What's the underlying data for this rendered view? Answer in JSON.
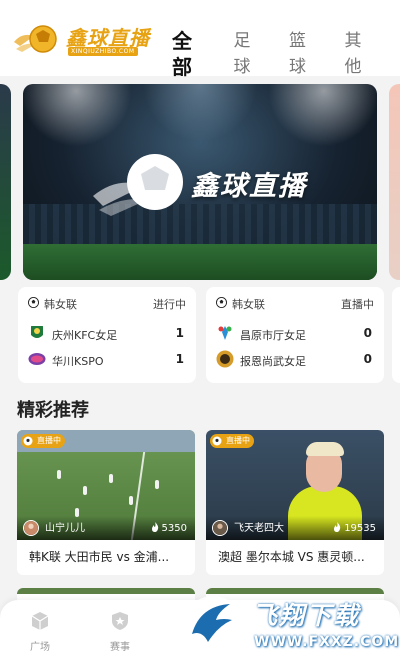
{
  "header": {
    "logo_title": "鑫球直播",
    "logo_subtitle": "XINQIUZHIBO.COM",
    "tabs": [
      {
        "label": "全部",
        "active": true
      },
      {
        "label": "足球",
        "active": false
      },
      {
        "label": "篮球",
        "active": false
      },
      {
        "label": "其他",
        "active": false
      }
    ]
  },
  "banner": {
    "title": "鑫球直播"
  },
  "matches": [
    {
      "league": "韩女联",
      "status": "进行中",
      "home": {
        "name": "庆州KFC女足",
        "score": "1"
      },
      "away": {
        "name": "华川KSPO",
        "score": "1"
      }
    },
    {
      "league": "韩女联",
      "status": "直播中",
      "home": {
        "name": "昌原市厅女足",
        "score": "0"
      },
      "away": {
        "name": "报恩尚武女足",
        "score": "0"
      }
    }
  ],
  "section": {
    "title": "精彩推荐"
  },
  "videos": [
    {
      "badge": "直播中",
      "host": "山宁儿儿",
      "views": "5350",
      "title": "韩K联 大田市民 vs 金浦..."
    },
    {
      "badge": "直播中",
      "host": "飞天老四大",
      "views": "19535",
      "title": "澳超 墨尔本城 VS 惠灵顿..."
    }
  ],
  "bottom_nav": [
    {
      "label": "广场",
      "icon": "cube-icon"
    },
    {
      "label": "赛事",
      "icon": "shield-icon"
    }
  ],
  "watermark": {
    "title": "飞翔下载",
    "url": "WWW.FXXZ.COM"
  },
  "colors": {
    "brand": "#e8a314",
    "background": "#f3f3f3",
    "card": "#ffffff"
  }
}
